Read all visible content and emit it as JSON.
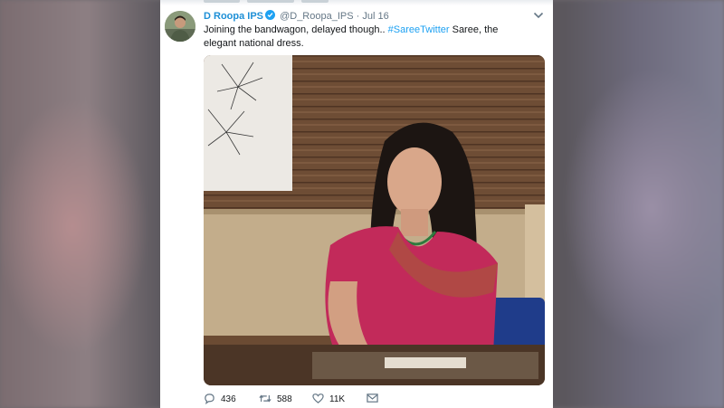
{
  "tweet": {
    "author_name": "D Roopa IPS",
    "handle": "@D_Roopa_IPS",
    "separator": "·",
    "date": "Jul 16",
    "text_before": "Joining the bandwagon, delayed though.. ",
    "hashtag": "#SareeTwitter",
    "text_after": "  Saree, the elegant national dress."
  },
  "actions": {
    "replies": "436",
    "retweets": "588",
    "likes": "11K"
  },
  "colors": {
    "accent": "#1da1f2",
    "name": "#1d8fd6",
    "muted": "#657786"
  },
  "icons": {
    "verified": "verified-badge-icon",
    "menu": "chevron-down-icon",
    "reply": "reply-icon",
    "retweet": "retweet-icon",
    "like": "heart-icon",
    "dm": "envelope-icon"
  }
}
